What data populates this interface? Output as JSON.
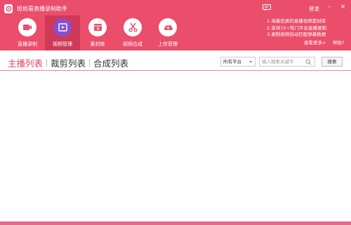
{
  "app": {
    "title": "斑斑看直播录制助手"
  },
  "header": {
    "login_label": "登录",
    "minimize_symbol": "–",
    "close_symbol": "×",
    "accent_color": "#ea4e6b",
    "active_color": "#8a4ed1"
  },
  "nav": {
    "items": [
      {
        "label": "直播录制",
        "icon": "video-record-icon",
        "active": false
      },
      {
        "label": "视频管理",
        "icon": "video-manage-icon",
        "active": true
      },
      {
        "label": "素材库",
        "icon": "material-library-icon",
        "active": false
      },
      {
        "label": "视频合成",
        "icon": "scissors-icon",
        "active": false
      },
      {
        "label": "上传管理",
        "icon": "cloud-upload-icon",
        "active": false
      }
    ]
  },
  "promo": {
    "lines": [
      "1.海量优质的直播视频素材库",
      "2.支持15+热门平台直播录制",
      "3.录制视频自动匹配弹幕数据"
    ],
    "more_label": "查看更多>",
    "help_label": "帮助?"
  },
  "tabs": [
    {
      "label": "主播列表",
      "active": true
    },
    {
      "label": "裁剪列表",
      "active": false
    },
    {
      "label": "合成列表",
      "active": false
    }
  ],
  "filter": {
    "platform_value": "所有平台",
    "search_placeholder": "输入搜索关键字",
    "search_button_label": "搜索"
  }
}
